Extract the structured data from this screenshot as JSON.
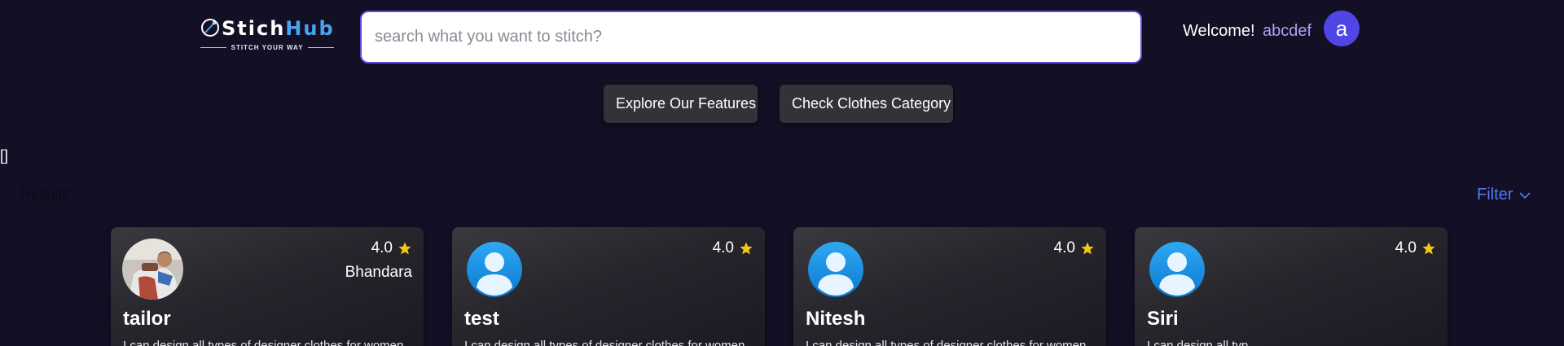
{
  "header": {
    "logo": {
      "word_part1": "Stich",
      "word_part2": "Hub",
      "tagline": "STITCH YOUR WAY"
    },
    "search": {
      "placeholder": "search what you want to stitch?",
      "value": ""
    },
    "welcome_text": "Welcome!",
    "username": "abcdef",
    "avatar_letter": "a"
  },
  "nav": {
    "explore_label": "Explore Our Features",
    "category_label": "Check Clothes Category"
  },
  "stray_text": "[]",
  "results": {
    "label": "Results:",
    "filter_label": "Filter"
  },
  "cards": [
    {
      "name": "tailor",
      "rating": "4.0",
      "location": "Bhandara",
      "avatar": "photo",
      "description": "I can design all types of designer clothes for women"
    },
    {
      "name": "test",
      "rating": "4.0",
      "location": "",
      "avatar": "default",
      "description": "I can design all types of designer clothes for women"
    },
    {
      "name": "Nitesh",
      "rating": "4.0",
      "location": "",
      "avatar": "default",
      "description": "I can design all types of designer clothes for women"
    },
    {
      "name": "Siri",
      "rating": "4.0",
      "location": "",
      "avatar": "default",
      "description": "I can design all typ"
    }
  ],
  "colors": {
    "background": "#130f25",
    "accent": "#4f46e5",
    "search_border": "#5b4fe0",
    "star": "#f5c518",
    "filter": "#4f7cf0",
    "username": "#a7a6f5"
  }
}
